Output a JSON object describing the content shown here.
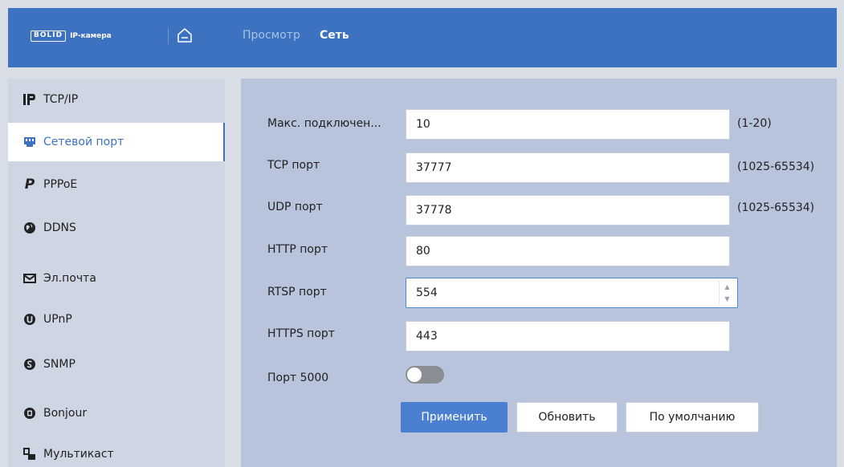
{
  "header": {
    "logo_box": "BOLID",
    "logo_text": "IP-камера",
    "tabs": [
      {
        "label": "Просмотр",
        "active": false
      },
      {
        "label": "Сеть",
        "active": true
      }
    ]
  },
  "sidebar": {
    "items": [
      {
        "label": "TCP/IP",
        "icon": "ip-icon",
        "active": false
      },
      {
        "label": "Сетевой порт",
        "icon": "network-port-icon",
        "active": true
      },
      {
        "label": "PPPoE",
        "icon": "p-icon",
        "active": false
      },
      {
        "label": "DDNS",
        "icon": "globe-icon",
        "active": false
      },
      {
        "label": "Эл.почта",
        "icon": "mail-icon",
        "active": false
      },
      {
        "label": "UPnP",
        "icon": "upnp-icon",
        "active": false
      },
      {
        "label": "SNMP",
        "icon": "snmp-icon",
        "active": false
      },
      {
        "label": "Bonjour",
        "icon": "bonjour-icon",
        "active": false
      },
      {
        "label": "Мультикаст",
        "icon": "multicast-icon",
        "active": false
      }
    ]
  },
  "form": {
    "fields": [
      {
        "label": "Макс. подключен...",
        "value": "10",
        "range": "(1-20)"
      },
      {
        "label": "TCP порт",
        "value": "37777",
        "range": "(1025-65534)"
      },
      {
        "label": "UDP порт",
        "value": "37778",
        "range": "(1025-65534)"
      },
      {
        "label": "HTTP порт",
        "value": "80",
        "range": ""
      },
      {
        "label": "RTSP порт",
        "value": "554",
        "range": ""
      },
      {
        "label": "HTTPS порт",
        "value": "443",
        "range": ""
      }
    ],
    "port5000": {
      "label": "Порт 5000",
      "enabled": false
    }
  },
  "buttons": {
    "apply": "Применить",
    "refresh": "Обновить",
    "default": "По умолчанию"
  },
  "colors": {
    "accent": "#3c72bf",
    "primary_button": "#4a80cf",
    "panel": "#b7c4db",
    "sidebar": "#cfd6e3"
  }
}
